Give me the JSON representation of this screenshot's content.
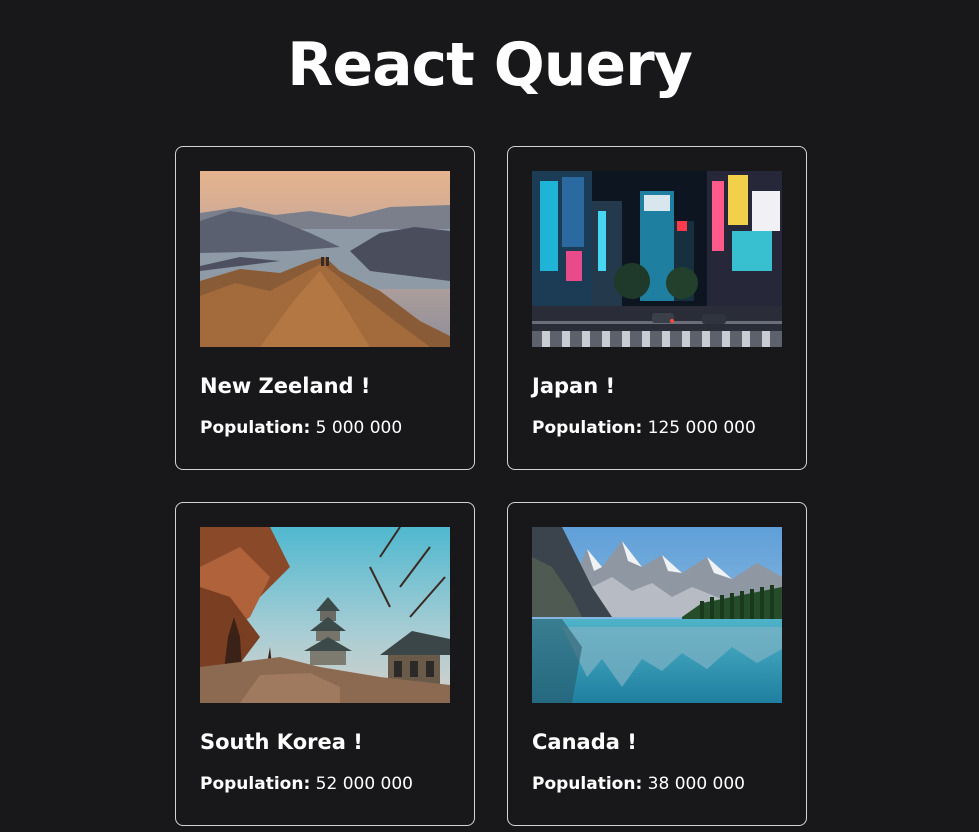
{
  "header": {
    "title": "React Query"
  },
  "population_label": "Population:",
  "countries": [
    {
      "name": "New Zeeland !",
      "population": "5 000 000",
      "image": "mountain-lake-landscape"
    },
    {
      "name": "Japan !",
      "population": "125 000 000",
      "image": "neon-city-street"
    },
    {
      "name": "South Korea !",
      "population": "52 000 000",
      "image": "pagoda-autumn-trees"
    },
    {
      "name": "Canada !",
      "population": "38 000 000",
      "image": "mountain-lake-reflection"
    }
  ],
  "colors": {
    "background": "#18181b",
    "card_border": "#d4d4d8",
    "text": "#ffffff"
  }
}
